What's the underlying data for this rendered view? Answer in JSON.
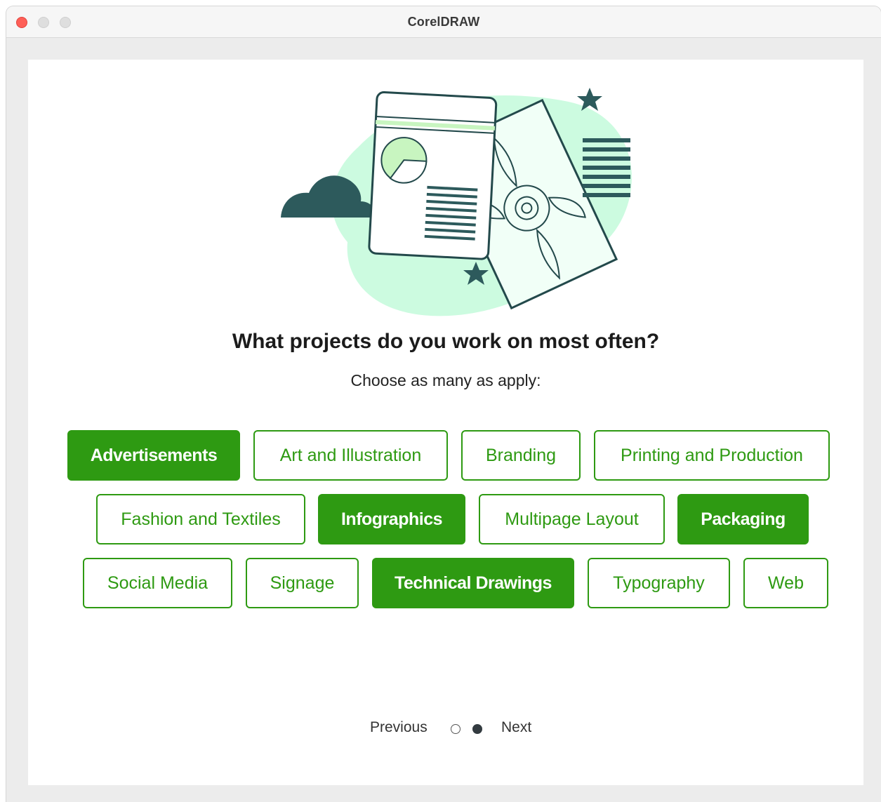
{
  "window": {
    "title": "CorelDRAW"
  },
  "prompt": {
    "heading": "What projects do you work on most often?",
    "subheading": "Choose as many as apply:"
  },
  "options": [
    {
      "label": "Advertisements",
      "selected": true
    },
    {
      "label": "Art and Illustration",
      "selected": false
    },
    {
      "label": "Branding",
      "selected": false
    },
    {
      "label": "Printing and Production",
      "selected": false
    },
    {
      "label": "Fashion and Textiles",
      "selected": false
    },
    {
      "label": "Infographics",
      "selected": true
    },
    {
      "label": "Multipage Layout",
      "selected": false
    },
    {
      "label": "Packaging",
      "selected": true
    },
    {
      "label": "Social Media",
      "selected": false
    },
    {
      "label": "Signage",
      "selected": false
    },
    {
      "label": "Technical Drawings",
      "selected": true
    },
    {
      "label": "Typography",
      "selected": false
    },
    {
      "label": "Web",
      "selected": false
    }
  ],
  "pager": {
    "previous_label": "Previous",
    "next_label": "Next",
    "current_page": 2,
    "total_pages": 2
  },
  "colors": {
    "accent": "#2e9a12",
    "illustration_mint": "#ccfbe0",
    "illustration_dark": "#2d5a5c"
  }
}
